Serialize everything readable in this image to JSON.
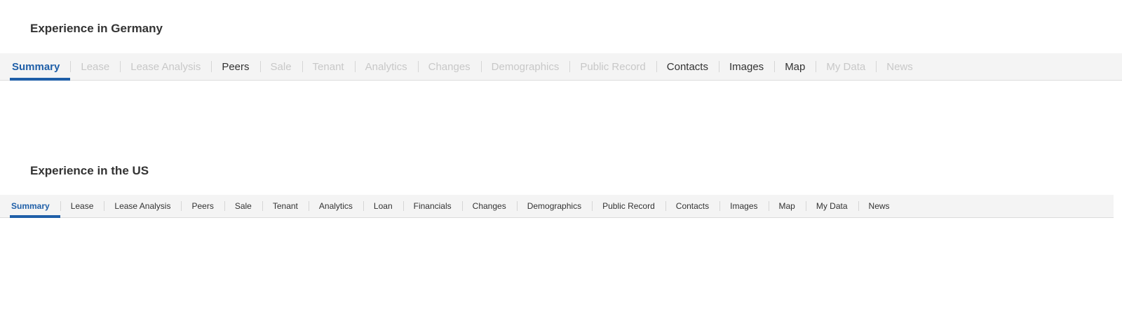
{
  "germany": {
    "title": "Experience in Germany",
    "tabs": [
      {
        "id": "summary",
        "label": "Summary",
        "state": "active"
      },
      {
        "id": "lease",
        "label": "Lease",
        "state": "disabled"
      },
      {
        "id": "lease-analysis",
        "label": "Lease Analysis",
        "state": "disabled"
      },
      {
        "id": "peers",
        "label": "Peers",
        "state": "enabled"
      },
      {
        "id": "sale",
        "label": "Sale",
        "state": "disabled"
      },
      {
        "id": "tenant",
        "label": "Tenant",
        "state": "disabled"
      },
      {
        "id": "analytics",
        "label": "Analytics",
        "state": "disabled"
      },
      {
        "id": "changes",
        "label": "Changes",
        "state": "disabled"
      },
      {
        "id": "demographics",
        "label": "Demographics",
        "state": "disabled"
      },
      {
        "id": "public-record",
        "label": "Public Record",
        "state": "disabled"
      },
      {
        "id": "contacts",
        "label": "Contacts",
        "state": "enabled"
      },
      {
        "id": "images",
        "label": "Images",
        "state": "enabled"
      },
      {
        "id": "map",
        "label": "Map",
        "state": "enabled"
      },
      {
        "id": "my-data",
        "label": "My Data",
        "state": "disabled"
      },
      {
        "id": "news",
        "label": "News",
        "state": "disabled"
      }
    ]
  },
  "us": {
    "title": "Experience in the US",
    "tabs": [
      {
        "id": "summary",
        "label": "Summary",
        "state": "active"
      },
      {
        "id": "lease",
        "label": "Lease",
        "state": "enabled"
      },
      {
        "id": "lease-analysis",
        "label": "Lease Analysis",
        "state": "enabled"
      },
      {
        "id": "peers",
        "label": "Peers",
        "state": "enabled"
      },
      {
        "id": "sale",
        "label": "Sale",
        "state": "enabled"
      },
      {
        "id": "tenant",
        "label": "Tenant",
        "state": "enabled"
      },
      {
        "id": "analytics",
        "label": "Analytics",
        "state": "enabled"
      },
      {
        "id": "loan",
        "label": "Loan",
        "state": "enabled"
      },
      {
        "id": "financials",
        "label": "Financials",
        "state": "enabled"
      },
      {
        "id": "changes",
        "label": "Changes",
        "state": "enabled"
      },
      {
        "id": "demographics",
        "label": "Demographics",
        "state": "enabled"
      },
      {
        "id": "public-record",
        "label": "Public Record",
        "state": "enabled"
      },
      {
        "id": "contacts",
        "label": "Contacts",
        "state": "enabled"
      },
      {
        "id": "images",
        "label": "Images",
        "state": "enabled"
      },
      {
        "id": "map",
        "label": "Map",
        "state": "enabled"
      },
      {
        "id": "my-data",
        "label": "My Data",
        "state": "enabled"
      },
      {
        "id": "news",
        "label": "News",
        "state": "enabled"
      }
    ]
  },
  "colors": {
    "active_tab": "#1f5fa8",
    "enabled_tab": "#333333",
    "disabled_tab": "#c8c8c8",
    "tabbar_background": "#f4f4f4"
  }
}
